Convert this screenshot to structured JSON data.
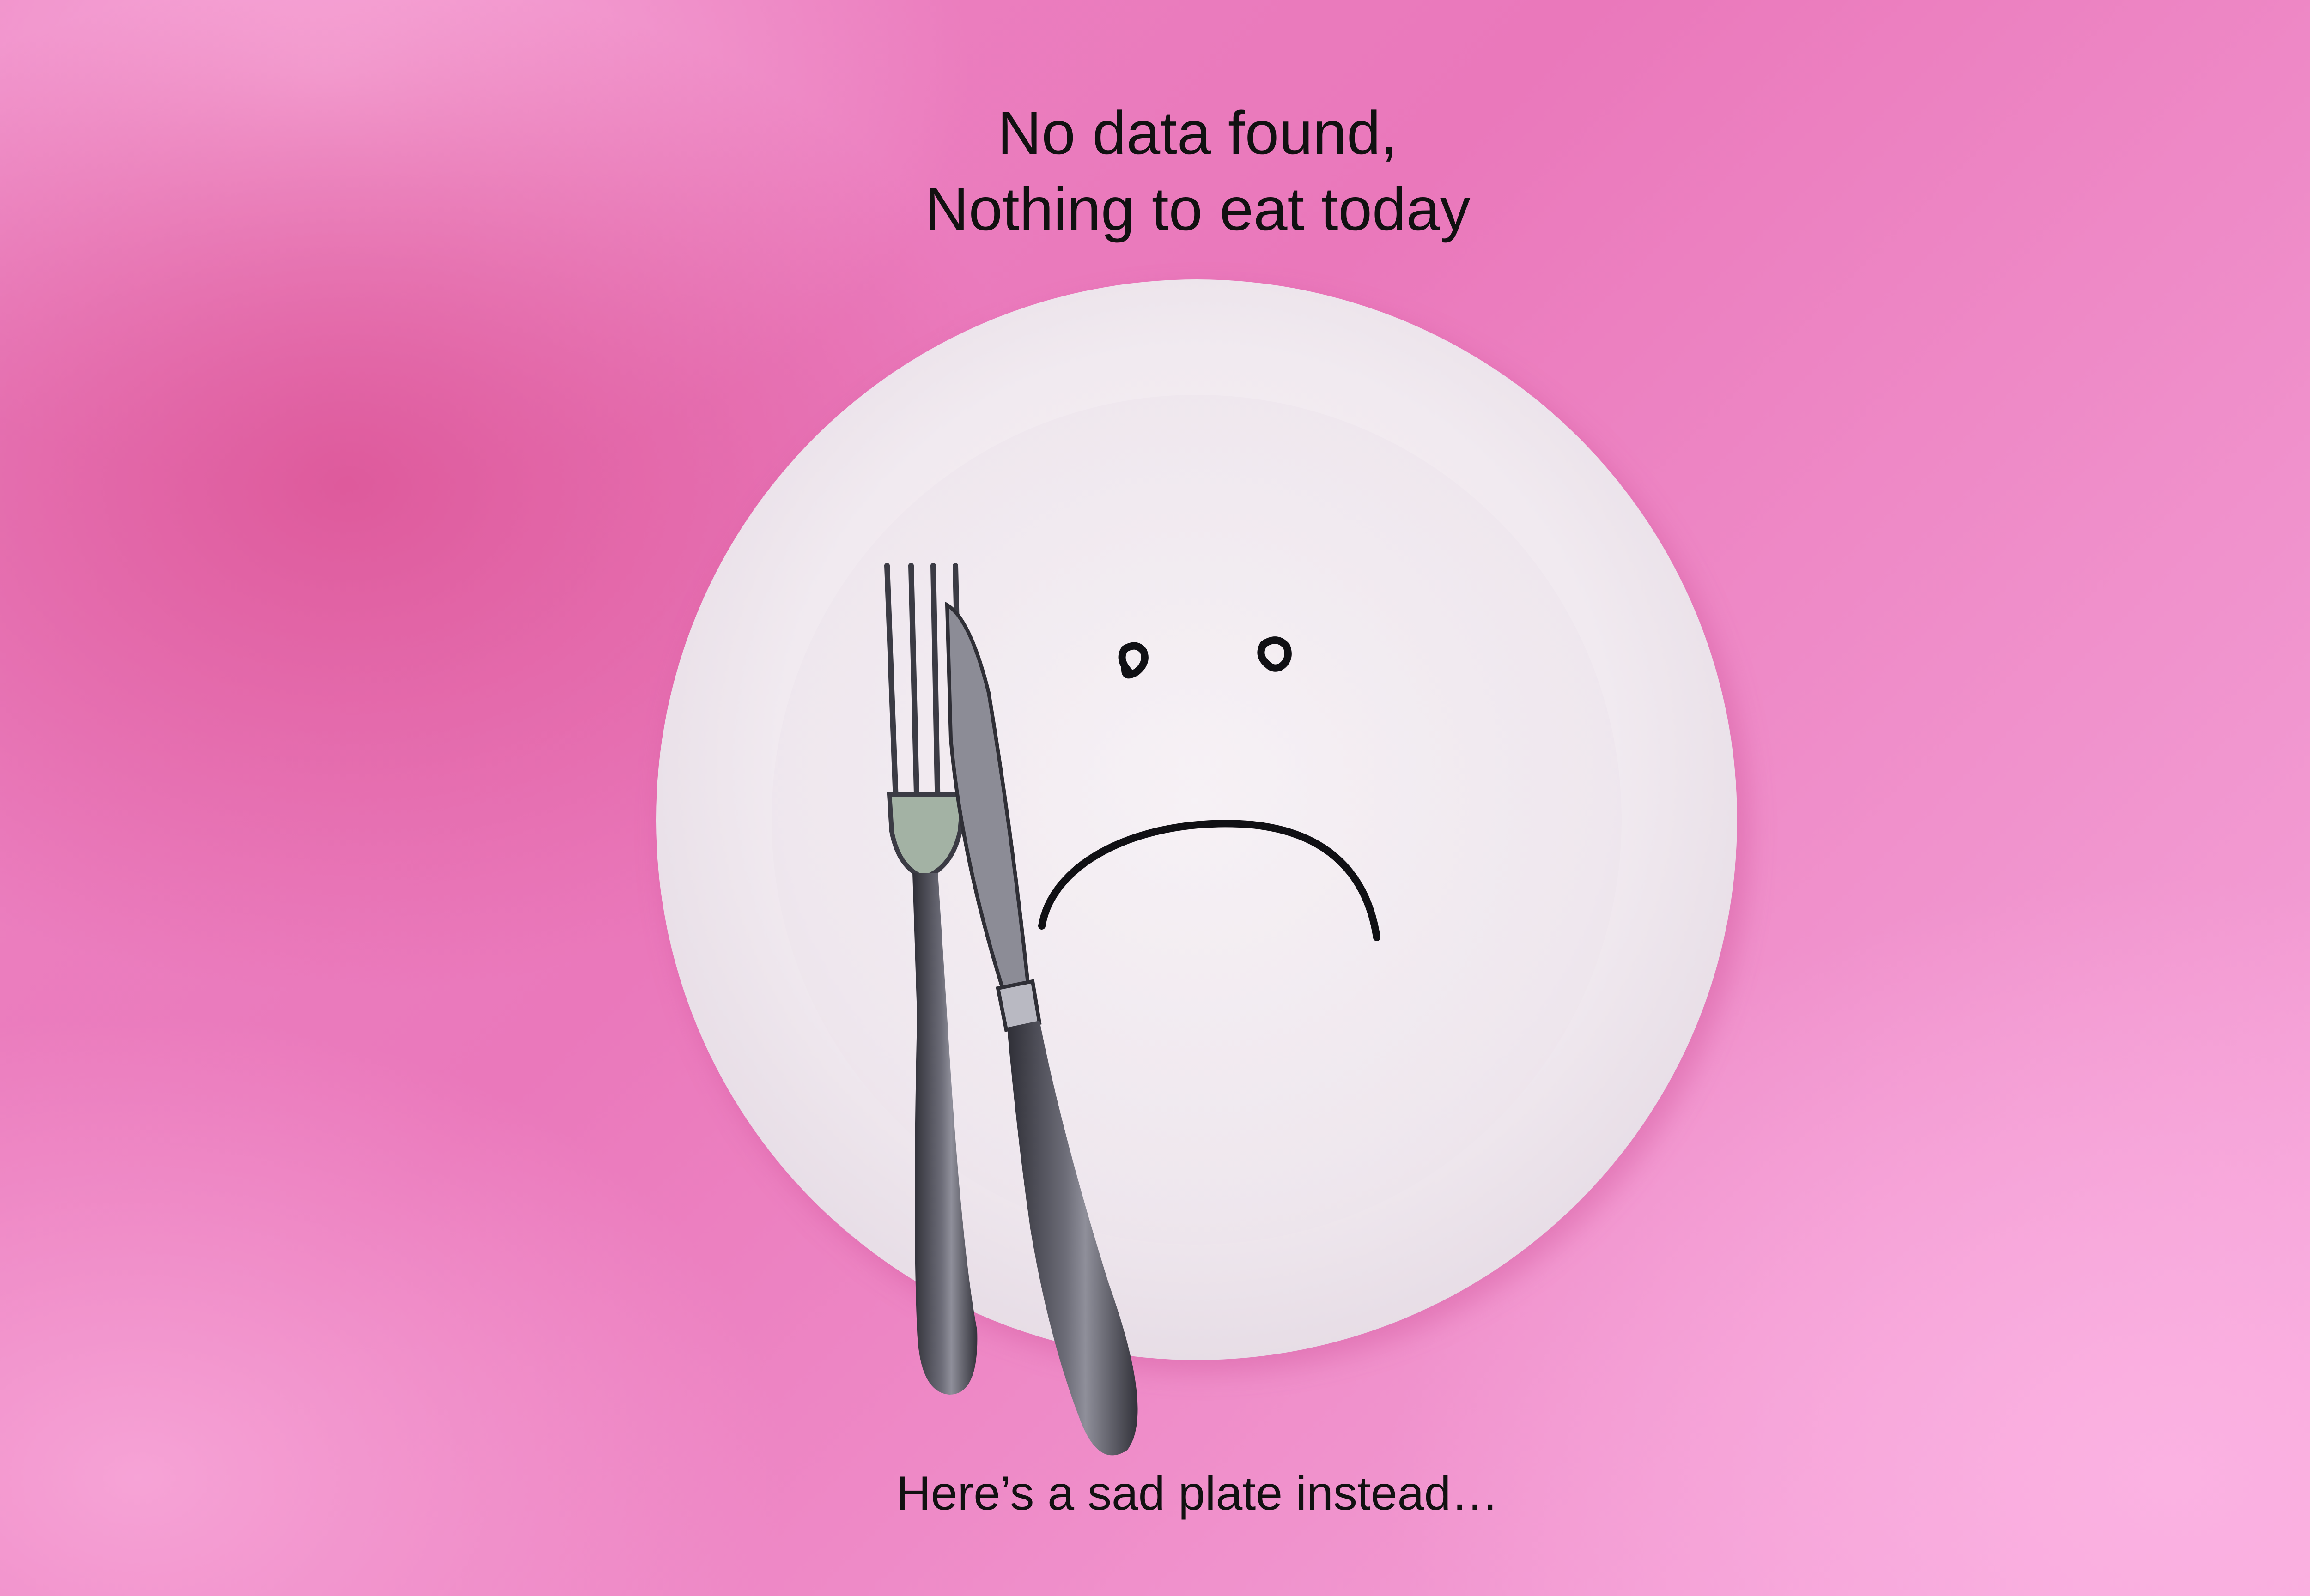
{
  "message": {
    "title_line_1": "No data found,",
    "title_line_2": "Nothing to eat today",
    "caption": "Here’s a sad plate instead…"
  },
  "illustration": {
    "subject": "empty white plate with sad face, fork and knife",
    "icons": [
      "plate-icon",
      "sad-face-icon",
      "fork-icon",
      "knife-icon"
    ]
  },
  "colors": {
    "background": "#ec85c3",
    "plate": "#f4eef3",
    "text": "#111111",
    "cutlery": "#4a4a52"
  }
}
